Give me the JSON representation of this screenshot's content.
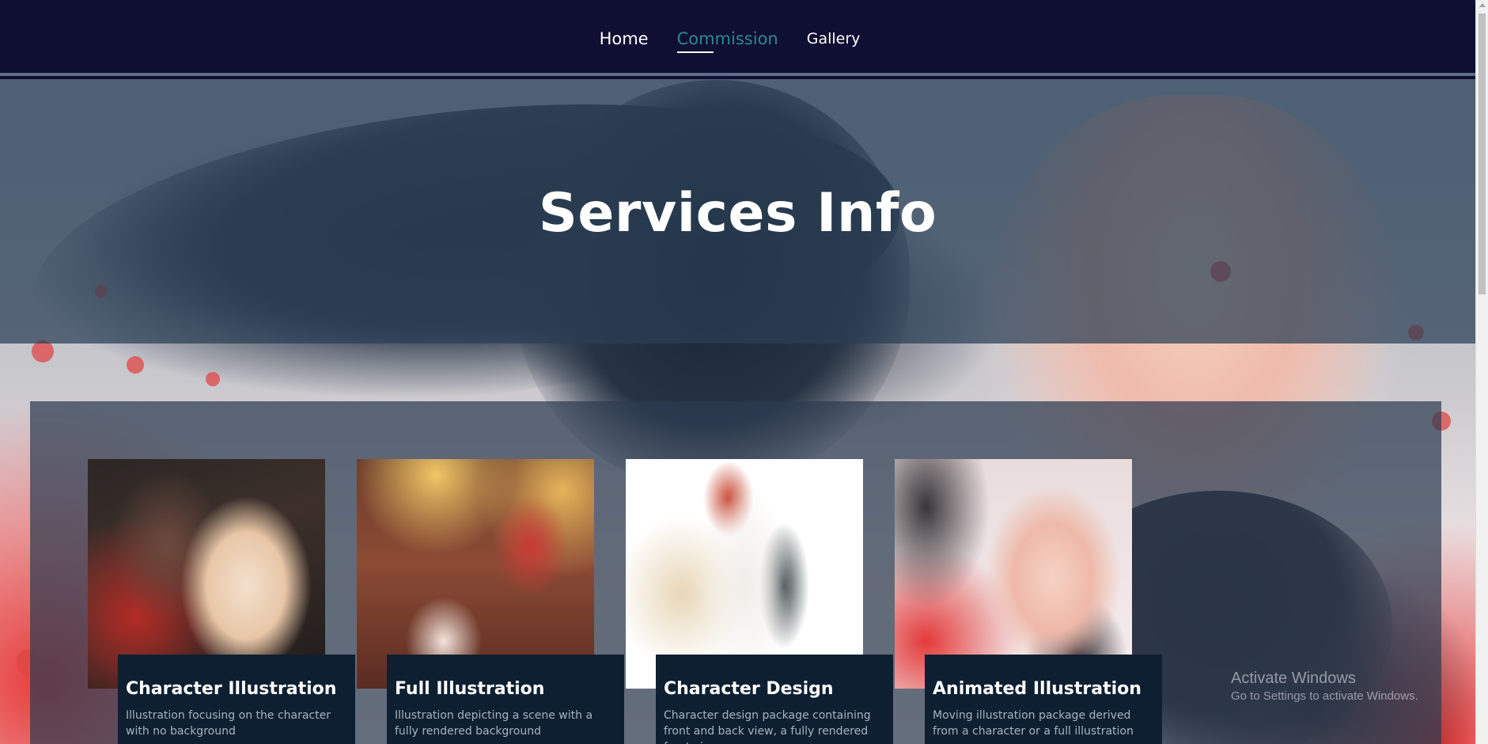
{
  "nav": {
    "items": [
      {
        "label": "Home",
        "active": false
      },
      {
        "label": "Commission",
        "active": true
      },
      {
        "label": "Gallery",
        "active": false
      }
    ],
    "active_color": "#2b8a8e",
    "background_color": "#0f0e33"
  },
  "hero": {
    "title": "Services Info"
  },
  "services": {
    "cards": [
      {
        "title": "Character Illustration",
        "description": "Illustration focusing on the character with no background"
      },
      {
        "title": "Full Illustration",
        "description": "Illustration depicting a scene with a fully rendered background"
      },
      {
        "title": "Character Design",
        "description": "Character design package containing front and back view, a fully rendered front view,"
      },
      {
        "title": "Animated Illustration",
        "description": "Moving illustration package derived from a character or a full illustration"
      }
    ]
  },
  "watermark": {
    "title": "Activate Windows",
    "subtitle": "Go to Settings to activate Windows."
  }
}
